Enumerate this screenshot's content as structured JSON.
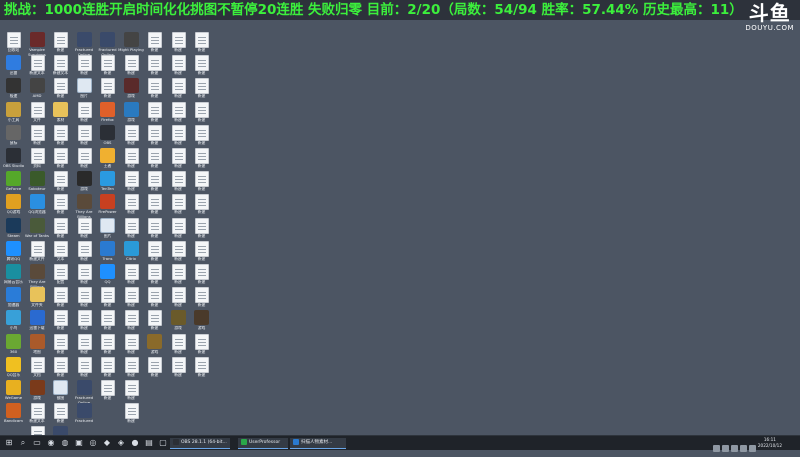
{
  "banner": {
    "text": "挑战：1000连胜开启时间化化挑图不暂停20连胜 失败归零 目前：2/20（局数：54/94 胜率：57.44% 历史最高：11）",
    "color": "#3cf03c"
  },
  "watermark": {
    "logo": "斗鱼",
    "url": "DOUYU.COM"
  },
  "desktop": {
    "columns": [
      [
        {
          "n": "回收站",
          "i": "doc"
        },
        {
          "n": "迅雷",
          "i": "app",
          "c": "#2f7ce0"
        },
        {
          "n": "极速",
          "i": "app",
          "c": "#333"
        },
        {
          "n": "小工具",
          "i": "app",
          "c": "#c8a03c"
        },
        {
          "n": "鼠标",
          "i": "app",
          "c": "#666"
        },
        {
          "n": "OBS Studio",
          "i": "app",
          "c": "#2b2f36"
        },
        {
          "n": "GeForce",
          "i": "app",
          "c": "#55a82a"
        },
        {
          "n": "QQ游戏",
          "i": "app",
          "c": "#e0a020"
        },
        {
          "n": "Steam",
          "i": "app",
          "c": "#1b3a5a"
        },
        {
          "n": "腾讯QQ",
          "i": "app",
          "c": "#1e90ff"
        },
        {
          "n": "网易云音乐",
          "i": "app",
          "c": "#1a8fa0"
        },
        {
          "n": "加速器",
          "i": "app",
          "c": "#2a7cd8"
        },
        {
          "n": "小鸟",
          "i": "app",
          "c": "#38a0d8"
        },
        {
          "n": "360",
          "i": "app",
          "c": "#6aa832"
        },
        {
          "n": "QQ音乐",
          "i": "app",
          "c": "#f0c020"
        },
        {
          "n": "WeGame",
          "i": "app",
          "c": "#e8b020"
        },
        {
          "n": "Bandicam",
          "i": "app",
          "c": "#d06020"
        }
      ],
      [
        {
          "n": "Vampire Survivors",
          "i": "app",
          "c": "#6a2a2a"
        },
        {
          "n": "新建文本",
          "i": "doc"
        },
        {
          "n": "AMD",
          "i": "app",
          "c": "#444"
        },
        {
          "n": "文件",
          "i": "doc"
        },
        {
          "n": "新建",
          "i": "doc"
        },
        {
          "n": "资料",
          "i": "doc"
        },
        {
          "n": "Saboteur",
          "i": "app",
          "c": "#3a5a2a"
        },
        {
          "n": "QQ浏览器",
          "i": "app",
          "c": "#2a8fe0"
        },
        {
          "n": "War of Tanks",
          "i": "app",
          "c": "#4a5a3a"
        },
        {
          "n": "新建文件",
          "i": "doc"
        },
        {
          "n": "They Are Billions",
          "i": "app",
          "c": "#5a4a3a"
        },
        {
          "n": "文件夹",
          "i": "folder"
        },
        {
          "n": "迅雷下载",
          "i": "app",
          "c": "#2a6ad0"
        },
        {
          "n": "地图",
          "i": "app",
          "c": "#aa5a2a"
        },
        {
          "n": "文档",
          "i": "doc"
        },
        {
          "n": "游戏",
          "i": "app",
          "c": "#7a3a1a"
        },
        {
          "n": "新建文本",
          "i": "doc"
        },
        {
          "n": "记录",
          "i": "doc"
        }
      ],
      [
        {
          "n": "新建",
          "i": "doc"
        },
        {
          "n": "新建文本",
          "i": "doc"
        },
        {
          "n": "新建",
          "i": "doc"
        },
        {
          "n": "素材",
          "i": "folder"
        },
        {
          "n": "新建",
          "i": "doc"
        },
        {
          "n": "新建",
          "i": "doc"
        },
        {
          "n": "新建",
          "i": "doc"
        },
        {
          "n": "新建",
          "i": "doc"
        },
        {
          "n": "新建",
          "i": "doc"
        },
        {
          "n": "文本",
          "i": "doc"
        },
        {
          "n": "配置",
          "i": "doc"
        },
        {
          "n": "新建",
          "i": "doc"
        },
        {
          "n": "新建",
          "i": "doc"
        },
        {
          "n": "新建",
          "i": "doc"
        },
        {
          "n": "新建",
          "i": "doc"
        },
        {
          "n": "截图",
          "i": "img"
        },
        {
          "n": "新建",
          "i": "doc"
        },
        {
          "n": "Fractured",
          "i": "app",
          "c": "#3a4a6a"
        }
      ],
      [
        {
          "n": "Fractured Online",
          "i": "app",
          "c": "#3a4a6a"
        },
        {
          "n": "新建",
          "i": "doc"
        },
        {
          "n": "图片",
          "i": "img"
        },
        {
          "n": "新建",
          "i": "doc"
        },
        {
          "n": "新建",
          "i": "doc"
        },
        {
          "n": "新建",
          "i": "doc"
        },
        {
          "n": "游戏",
          "i": "app",
          "c": "#2a2a2a"
        },
        {
          "n": "They Are Billions",
          "i": "app",
          "c": "#5a4a3a"
        },
        {
          "n": "新建",
          "i": "doc"
        },
        {
          "n": "新建",
          "i": "doc"
        },
        {
          "n": "新建",
          "i": "doc"
        },
        {
          "n": "新建",
          "i": "doc"
        },
        {
          "n": "新建",
          "i": "doc"
        },
        {
          "n": "新建",
          "i": "doc"
        },
        {
          "n": "新建",
          "i": "doc"
        },
        {
          "n": "Fractured Online",
          "i": "app",
          "c": "#3a4a6a"
        },
        {
          "n": "Fractured",
          "i": "app",
          "c": "#3a4a6a"
        }
      ],
      [
        {
          "n": "Fractured Online",
          "i": "app",
          "c": "#3a4a6a"
        },
        {
          "n": "新建",
          "i": "doc"
        },
        {
          "n": "新建",
          "i": "doc"
        },
        {
          "n": "Firefox",
          "i": "app",
          "c": "#e0602a"
        },
        {
          "n": "OBS",
          "i": "app",
          "c": "#2b2f36"
        },
        {
          "n": "王者",
          "i": "app",
          "c": "#f0b030"
        },
        {
          "n": "TenTen",
          "i": "app",
          "c": "#2a9ae0"
        },
        {
          "n": "FirePower",
          "i": "app",
          "c": "#c84020"
        },
        {
          "n": "图片",
          "i": "img"
        },
        {
          "n": "Trans",
          "i": "app",
          "c": "#2a7ad0"
        },
        {
          "n": "QQ",
          "i": "app",
          "c": "#1e90ff"
        },
        {
          "n": "新建",
          "i": "doc"
        },
        {
          "n": "新建",
          "i": "doc"
        },
        {
          "n": "新建",
          "i": "doc"
        },
        {
          "n": "新建",
          "i": "doc"
        },
        {
          "n": "新建",
          "i": "doc"
        }
      ],
      [
        {
          "n": "Might Playing",
          "i": "app",
          "c": "#444"
        },
        {
          "n": "新建",
          "i": "doc"
        },
        {
          "n": "游戏",
          "i": "app",
          "c": "#5a2a2a"
        },
        {
          "n": "游戏",
          "i": "app",
          "c": "#2a7ac0"
        },
        {
          "n": "新建",
          "i": "doc"
        },
        {
          "n": "新建",
          "i": "doc"
        },
        {
          "n": "新建",
          "i": "doc"
        },
        {
          "n": "新建",
          "i": "doc"
        },
        {
          "n": "新建",
          "i": "doc"
        },
        {
          "n": "Citrix",
          "i": "app",
          "c": "#2a9ad8"
        },
        {
          "n": "新建",
          "i": "doc"
        },
        {
          "n": "新建",
          "i": "doc"
        },
        {
          "n": "新建",
          "i": "doc"
        },
        {
          "n": "新建",
          "i": "doc"
        },
        {
          "n": "新建",
          "i": "doc"
        },
        {
          "n": "新建",
          "i": "doc"
        },
        {
          "n": "新建",
          "i": "doc"
        }
      ],
      [
        {
          "n": "新建",
          "i": "doc"
        },
        {
          "n": "新建",
          "i": "doc"
        },
        {
          "n": "新建",
          "i": "doc"
        },
        {
          "n": "新建",
          "i": "doc"
        },
        {
          "n": "新建",
          "i": "doc"
        },
        {
          "n": "新建",
          "i": "doc"
        },
        {
          "n": "新建",
          "i": "doc"
        },
        {
          "n": "新建",
          "i": "doc"
        },
        {
          "n": "新建",
          "i": "doc"
        },
        {
          "n": "新建",
          "i": "doc"
        },
        {
          "n": "新建",
          "i": "doc"
        },
        {
          "n": "新建",
          "i": "doc"
        },
        {
          "n": "新建",
          "i": "doc"
        },
        {
          "n": "游戏",
          "i": "app",
          "c": "#8a6a2a"
        },
        {
          "n": "新建",
          "i": "doc"
        }
      ],
      [
        {
          "n": "新建",
          "i": "doc"
        },
        {
          "n": "新建",
          "i": "doc"
        },
        {
          "n": "新建",
          "i": "doc"
        },
        {
          "n": "新建",
          "i": "doc"
        },
        {
          "n": "新建",
          "i": "doc"
        },
        {
          "n": "新建",
          "i": "doc"
        },
        {
          "n": "新建",
          "i": "doc"
        },
        {
          "n": "新建",
          "i": "doc"
        },
        {
          "n": "新建",
          "i": "doc"
        },
        {
          "n": "新建",
          "i": "doc"
        },
        {
          "n": "新建",
          "i": "doc"
        },
        {
          "n": "新建",
          "i": "doc"
        },
        {
          "n": "游戏",
          "i": "app",
          "c": "#6a5a2a"
        },
        {
          "n": "新建",
          "i": "doc"
        },
        {
          "n": "新建",
          "i": "doc"
        }
      ],
      [
        {
          "n": "新建",
          "i": "doc"
        },
        {
          "n": "新建",
          "i": "doc"
        },
        {
          "n": "新建",
          "i": "doc"
        },
        {
          "n": "新建",
          "i": "doc"
        },
        {
          "n": "新建",
          "i": "doc"
        },
        {
          "n": "新建",
          "i": "doc"
        },
        {
          "n": "新建",
          "i": "doc"
        },
        {
          "n": "新建",
          "i": "doc"
        },
        {
          "n": "新建",
          "i": "doc"
        },
        {
          "n": "新建",
          "i": "doc"
        },
        {
          "n": "新建",
          "i": "doc"
        },
        {
          "n": "新建",
          "i": "doc"
        },
        {
          "n": "游戏",
          "i": "app",
          "c": "#4a3a2a"
        },
        {
          "n": "新建",
          "i": "doc"
        },
        {
          "n": "新建",
          "i": "doc"
        }
      ]
    ]
  },
  "taskbar": {
    "apps": [
      {
        "label": "OBS 28.1.1 (64-bit...",
        "color": "#2b2f36"
      },
      {
        "label": "UserProfessor",
        "color": "#2aa84a"
      },
      {
        "label": "扫描人物素材...",
        "color": "#2a7ad0"
      }
    ],
    "clock_time": "16:11",
    "clock_date": "2022/10/12"
  }
}
